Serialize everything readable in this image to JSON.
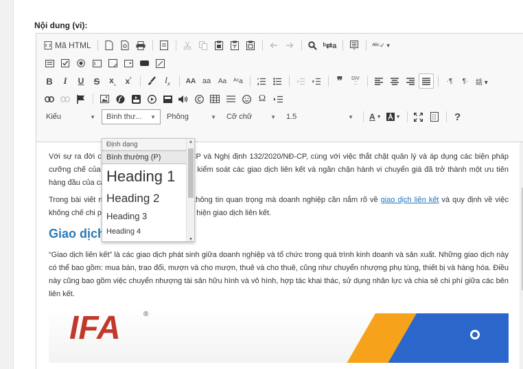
{
  "field": {
    "label": "Nội dung (vi):"
  },
  "toolbar": {
    "source_label": "Mã HTML",
    "styles_combo": "Kiểu",
    "format_combo": "Bình thư...",
    "font_combo": "Phông",
    "size_combo": "Cỡ chữ",
    "lineheight_combo": "1.5",
    "help_label": "?"
  },
  "dropdown": {
    "header": "Định dạng",
    "items": [
      "Bình thường (P)",
      "Heading 1",
      "Heading 2",
      "Heading 3",
      "Heading 4"
    ]
  },
  "content": {
    "p1": "Với sự ra đời của Nghị định 20/2017/NĐ-CP và Nghị định 132/2020/NĐ-CP, cùng với việc thắt chặt quản lý và áp dụng các biện pháp cưỡng chế của cơ quan quản lý thuế, việc kiểm soát các giao dịch liên kết và ngăn chặn hành vi chuyển giá đã trở thành một ưu tiên hàng đầu của các quốc.",
    "p2_before": "Trong bài viết này, chúng tôi sẽ cung cấp thông tin quan trọng mà doanh nghiệp cần nắm rõ về ",
    "p2_link": "giao dịch liên kết",
    "p2_after": " và quy định về việc khống chế chi phí lãi vay giữa các bên thực hiện giao dịch liên kết.",
    "heading": "Giao dịch liên kết là gì?",
    "p3": "“Giao dịch liên kết” là các giao dịch phát sinh giữa doanh nghiệp và tổ chức trong quá trình kinh doanh và sản xuất. Những giao dịch này có thể bao gồm: mua bán, trao đổi, mượn và cho mượn, thuê và cho thuê, cũng như chuyển nhượng phụ tùng, thiết bị và hàng hóa. Điều này cũng bao gồm việc chuyển nhượng tài sản hữu hình và vô hình, hợp tác khai thác, sử dụng nhân lực và chia sẻ chi phí giữa các bên liên kết.",
    "banner_logo": "IFA",
    "banner_reg": "®"
  },
  "colors": {
    "link": "#1e73be",
    "heading": "#2a7ab8",
    "orange": "#f6a31b",
    "blue": "#2b66ca"
  }
}
